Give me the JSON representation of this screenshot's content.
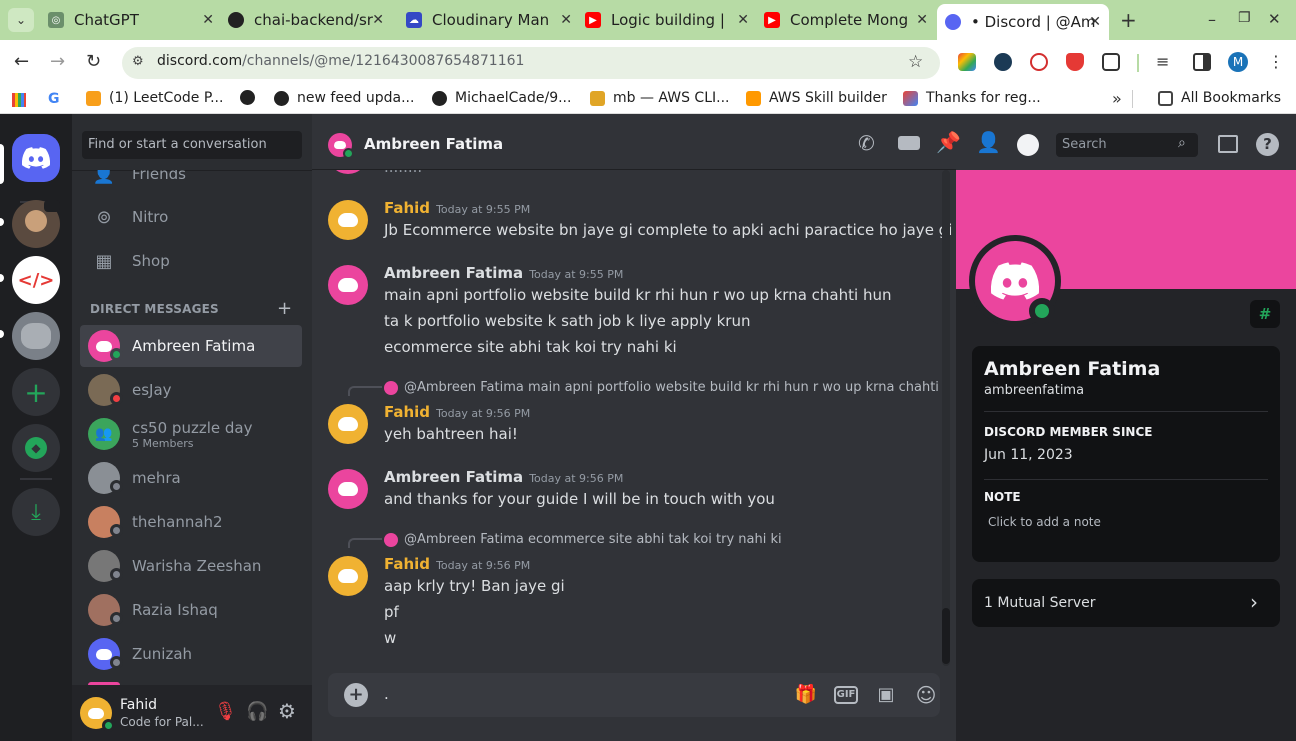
{
  "browser": {
    "tabs": [
      {
        "title": "ChatGPT",
        "icon": "chatgpt-icon"
      },
      {
        "title": "chai-backend/sr",
        "icon": "github-icon"
      },
      {
        "title": "Cloudinary Man",
        "icon": "cloudinary-icon"
      },
      {
        "title": "Logic building |",
        "icon": "youtube-icon"
      },
      {
        "title": "Complete Mong",
        "icon": "youtube-icon"
      },
      {
        "title": "• Discord | @Am",
        "icon": "discord-icon",
        "active": true
      }
    ],
    "url_host": "discord.com",
    "url_path": "/channels/@me/1216430087654871161",
    "profile_initial": "M",
    "bookmarks": [
      {
        "label": "(1) LeetCode P...",
        "icon": "leetcode-icon"
      },
      {
        "label": "new feed upda...",
        "icon": "globe-icon"
      },
      {
        "label": "MichaelCade/9...",
        "icon": "github-icon"
      },
      {
        "label": "mb — AWS CLI...",
        "icon": "folder-icon"
      },
      {
        "label": "AWS Skill builder",
        "icon": "aws-icon"
      },
      {
        "label": "Thanks for reg...",
        "icon": "gmail-icon"
      }
    ],
    "all_bookmarks_label": "All Bookmarks"
  },
  "dm_sidebar": {
    "search_placeholder": "Find or start a conversation",
    "nav": [
      {
        "label": "Friends",
        "icon": "friends-icon"
      },
      {
        "label": "Nitro",
        "icon": "nitro-icon"
      },
      {
        "label": "Shop",
        "icon": "shop-icon"
      }
    ],
    "section_title": "DIRECT MESSAGES",
    "dms": [
      {
        "name": "Ambreen Fatima",
        "status": "online",
        "avatar_color": "#eb459e",
        "active": true
      },
      {
        "name": "esJay",
        "status": "dnd",
        "avatar_color": "#7a6a55"
      },
      {
        "name": "cs50 puzzle day",
        "sub": "5 Members",
        "status": "",
        "avatar_color": "#3ba55c",
        "group": true
      },
      {
        "name": "mehra",
        "status": "offline",
        "avatar_color": "#8a8f95"
      },
      {
        "name": "thehannah2",
        "status": "offline",
        "avatar_color": "#c88060"
      },
      {
        "name": "Warisha Zeeshan",
        "status": "offline",
        "avatar_color": "#777777"
      },
      {
        "name": "Razia Ishaq",
        "status": "offline",
        "avatar_color": "#a07060"
      },
      {
        "name": "Zunizah",
        "status": "offline",
        "avatar_color": "#5865f2"
      }
    ],
    "user": {
      "name": "Fahid",
      "status_text": "Code for Pal..."
    }
  },
  "chat": {
    "recipient": "Ambreen Fatima",
    "search_placeholder": "Search",
    "top_cut_text": "........",
    "messages": [
      {
        "author": "Fahid",
        "author_color": "#f0b232",
        "avatar_color": "#f0b232",
        "time": "Today at 9:55 PM",
        "lines": [
          "Jb Ecommerce website bn jaye gi complete to apki achi paractice ho jaye gi"
        ]
      },
      {
        "author": "Ambreen Fatima",
        "author_color": "#dbdee1",
        "avatar_color": "#eb459e",
        "time": "Today at 9:55 PM",
        "lines": [
          "main apni portfolio website build kr rhi hun r wo up krna chahti hun",
          "ta k portfolio website k sath job k liye apply krun",
          "ecommerce site abhi tak koi try nahi ki"
        ]
      },
      {
        "author": "Fahid",
        "author_color": "#f0b232",
        "avatar_color": "#f0b232",
        "time": "Today at 9:56 PM",
        "reply_to": "@Ambreen Fatima",
        "reply_text": "main apni portfolio website build kr rhi hun r wo up krna chahti",
        "lines": [
          "yeh bahtreen hai!"
        ]
      },
      {
        "author": "Ambreen Fatima",
        "author_color": "#dbdee1",
        "avatar_color": "#eb459e",
        "time": "Today at 9:56 PM",
        "lines": [
          "and thanks for your guide I will be in touch with you"
        ]
      },
      {
        "author": "Fahid",
        "author_color": "#f0b232",
        "avatar_color": "#f0b232",
        "time": "Today at 9:56 PM",
        "reply_to": "@Ambreen Fatima",
        "reply_text": "ecommerce site abhi tak koi try nahi ki",
        "lines": [
          "aap krly try! Ban jaye gi",
          "pf",
          "w"
        ]
      }
    ],
    "composer_value": "."
  },
  "profile": {
    "banner_color": "#eb459e",
    "display_name": "Ambreen Fatima",
    "username": "ambreenfatima",
    "member_since_label": "DISCORD MEMBER SINCE",
    "member_since": "Jun 11, 2023",
    "note_label": "NOTE",
    "note_placeholder": "Click to add a note",
    "mutual": "1 Mutual Server"
  }
}
